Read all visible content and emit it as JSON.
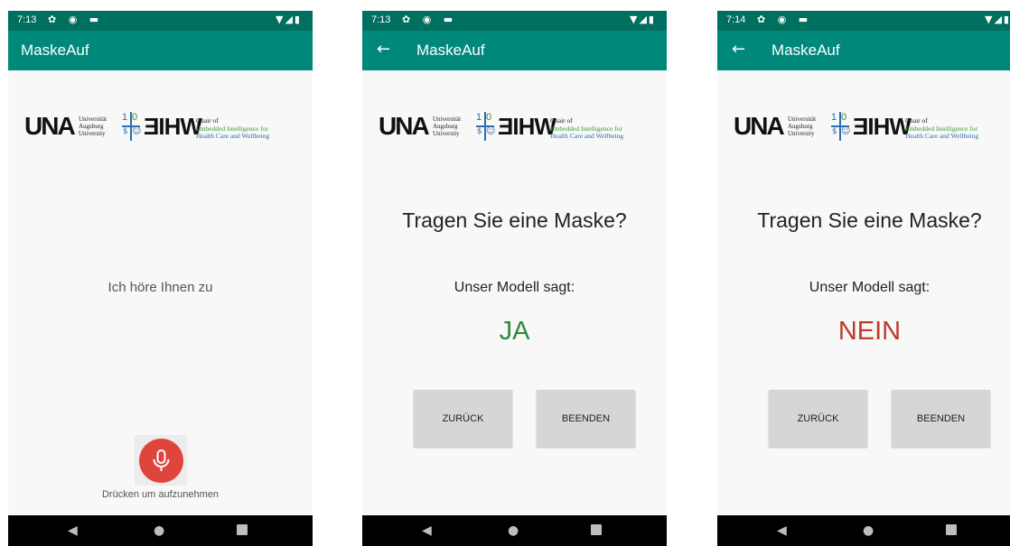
{
  "colors": {
    "status_bar": "#006f5f",
    "app_bar": "#00897b",
    "answer_yes": "#2e8b3a",
    "answer_no": "#c0392b",
    "mic_button": "#e0453c",
    "nav_bar": "#000000"
  },
  "logos": {
    "un_mark": "UNA",
    "university_lines": [
      "Universität",
      "Augsburg",
      "University"
    ],
    "ten_digits": [
      "1",
      "0"
    ],
    "eihw_mark": "ƎIHW",
    "chair_lines": [
      "Chair of",
      "Embedded Intelligence for",
      "Health Care and Wellbeing"
    ]
  },
  "screens": [
    {
      "status": {
        "time": "7:13"
      },
      "app_bar": {
        "title": "MaskeAuf",
        "has_back": false
      },
      "listening_text": "Ich höre Ihnen zu",
      "mic_caption": "Drücken um aufzunehmen",
      "mic_icon": "microphone-icon"
    },
    {
      "status": {
        "time": "7:13"
      },
      "app_bar": {
        "title": "MaskeAuf",
        "has_back": true,
        "back_glyph": "←"
      },
      "question": "Tragen Sie eine Maske?",
      "model_says": "Unser Modell sagt:",
      "answer": "JA",
      "buttons": {
        "back": "ZURÜCK",
        "exit": "BEENDEN"
      }
    },
    {
      "status": {
        "time": "7:14"
      },
      "app_bar": {
        "title": "MaskeAuf",
        "has_back": true,
        "back_glyph": "←"
      },
      "question": "Tragen Sie eine Maske?",
      "model_says": "Unser Modell sagt:",
      "answer": "NEIN",
      "buttons": {
        "back": "ZURÜCK",
        "exit": "BEENDEN"
      }
    }
  ],
  "status_icons": {
    "left": "✿ ◉ ▬",
    "right": "▼◢▮"
  },
  "nav_icons": {
    "back": "◀",
    "home": "●",
    "recents": "square"
  }
}
